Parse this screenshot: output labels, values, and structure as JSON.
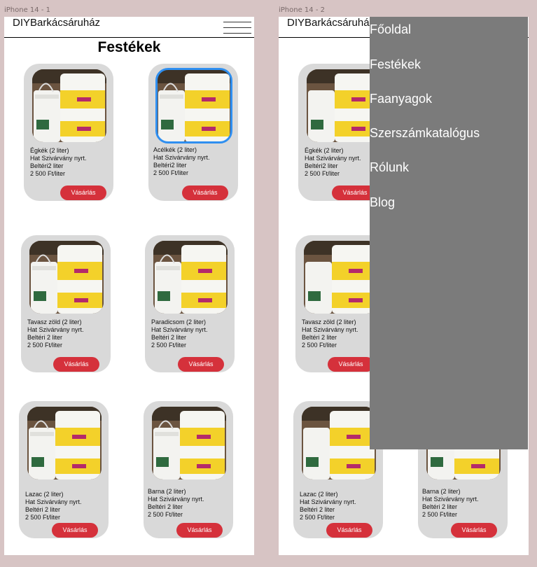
{
  "frames": [
    {
      "label": "iPhone 14 - 1"
    },
    {
      "label": "iPhone 14 - 2"
    }
  ],
  "header": {
    "brand": "DIYBarkácsáruház"
  },
  "page_title": "Festékek",
  "products": [
    {
      "name": "Égkék (2 liter)",
      "maker": "Hat Szivárvány nyrt.",
      "type": "Beltéri2 liter",
      "price": "2 500 Ft/liter",
      "button": "Vásárlás"
    },
    {
      "name": "Acélkék (2 liter)",
      "maker": "Hat Szivárvány nyrt.",
      "type": "Beltéri2 liter",
      "price": "2 500 Ft/liter",
      "button": "Vásárlás"
    },
    {
      "name": "Tavasz zöld (2 liter)",
      "maker": "Hat Szivárvány nyrt.",
      "type": "Beltéri 2 liter",
      "price": "2 500 Ft/liter",
      "button": "Vásárlás"
    },
    {
      "name": "Paradicsom (2 liter)",
      "maker": "Hat Szivárvány nyrt.",
      "type": "Beltéri 2 liter",
      "price": "2 500 Ft/liter",
      "button": "Vásárlás"
    },
    {
      "name": "Lazac (2 liter)",
      "maker": "Hat Szivárvány nyrt.",
      "type": "Beltéri 2 liter",
      "price": "2 500 Ft/liter",
      "button": "Vásárlás"
    },
    {
      "name": "Barna (2 liter)",
      "maker": "Hat Szivárvány nyrt.",
      "type": "Beltéri 2 liter",
      "price": "2 500 Ft/liter",
      "button": "Vásárlás"
    }
  ],
  "menu": {
    "items": [
      "Főoldal",
      "Festékek",
      "Faanyagok",
      "Szerszámkatalógus",
      "Rólunk",
      "Blog"
    ]
  },
  "colors": {
    "background": "#d7c4c4",
    "card": "#d9d9d9",
    "button": "#d5313b",
    "selected_outline": "#2f8ff0",
    "menu_overlay": "#7b7b7b"
  }
}
